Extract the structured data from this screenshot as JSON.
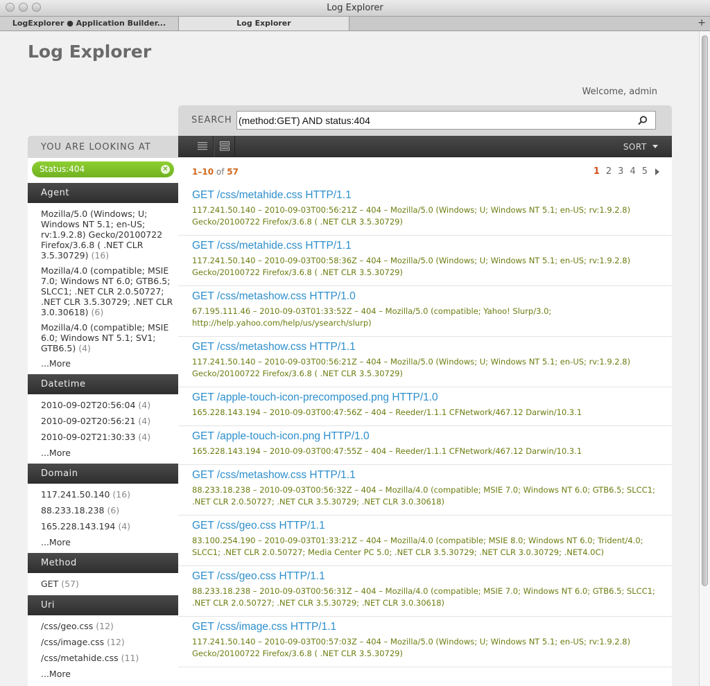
{
  "window": {
    "title": "Log Explorer"
  },
  "tabs": [
    {
      "label": "LogExplorer ● Application Builder..."
    },
    {
      "label": "Log Explorer"
    }
  ],
  "header": {
    "app_title": "Log Explorer",
    "welcome": "Welcome, admin"
  },
  "search": {
    "label": "SEARCH",
    "value": "(method:GET) AND status:404"
  },
  "sidebar": {
    "heading": "YOU ARE LOOKING AT",
    "active_filter": "Status:404",
    "facets": [
      {
        "title": "Agent",
        "items": [
          {
            "text": "Mozilla/5.0 (Windows; U; Windows NT 5.1; en-US; rv:1.9.2.8) Gecko/20100722 Firefox/3.6.8 ( .NET CLR 3.5.30729)",
            "count": "(16)"
          },
          {
            "text": "Mozilla/4.0 (compatible; MSIE 7.0; Windows NT 6.0; GTB6.5; SLCC1; .NET CLR 2.0.50727; .NET CLR 3.5.30729; .NET CLR 3.0.30618)",
            "count": "(6)"
          },
          {
            "text": "Mozilla/4.0 (compatible; MSIE 6.0; Windows NT 5.1; SV1; GTB6.5)",
            "count": "(4)"
          }
        ],
        "more": "...More"
      },
      {
        "title": "Datetime",
        "items": [
          {
            "text": "2010-09-02T20:56:04",
            "count": "(4)"
          },
          {
            "text": "2010-09-02T20:56:21",
            "count": "(4)"
          },
          {
            "text": "2010-09-02T21:30:33",
            "count": "(4)"
          }
        ],
        "more": "...More"
      },
      {
        "title": "Domain",
        "items": [
          {
            "text": "117.241.50.140",
            "count": "(16)"
          },
          {
            "text": "88.233.18.238",
            "count": "(6)"
          },
          {
            "text": "165.228.143.194",
            "count": "(4)"
          }
        ],
        "more": "...More"
      },
      {
        "title": "Method",
        "items": [
          {
            "text": "GET",
            "count": "(57)"
          }
        ],
        "more": ""
      },
      {
        "title": "Uri",
        "items": [
          {
            "text": "/css/geo.css",
            "count": "(12)"
          },
          {
            "text": "/css/image.css",
            "count": "(12)"
          },
          {
            "text": "/css/metahide.css",
            "count": "(11)"
          }
        ],
        "more": "...More"
      }
    ]
  },
  "results": {
    "sort_label": "SORT",
    "range": {
      "start_end": "1–10",
      "of": "of",
      "total": "57"
    },
    "pages": [
      "1",
      "2",
      "3",
      "4",
      "5"
    ],
    "current_page": "1",
    "entries": [
      {
        "request": "GET /css/metahide.css HTTP/1.1",
        "detail": "117.241.50.140 – 2010-09-03T00:56:21Z – 404 – Mozilla/5.0 (Windows; U; Windows NT 5.1; en-US; rv:1.9.2.8) Gecko/20100722 Firefox/3.6.8 ( .NET CLR 3.5.30729)"
      },
      {
        "request": "GET /css/metahide.css HTTP/1.1",
        "detail": "117.241.50.140 – 2010-09-03T00:58:36Z – 404 – Mozilla/5.0 (Windows; U; Windows NT 5.1; en-US; rv:1.9.2.8) Gecko/20100722 Firefox/3.6.8 ( .NET CLR 3.5.30729)"
      },
      {
        "request": "GET /css/metashow.css HTTP/1.0",
        "detail": "67.195.111.46 – 2010-09-03T01:33:52Z – 404 – Mozilla/5.0 (compatible; Yahoo! Slurp/3.0; http://help.yahoo.com/help/us/ysearch/slurp)"
      },
      {
        "request": "GET /css/metashow.css HTTP/1.1",
        "detail": "117.241.50.140 – 2010-09-03T00:56:21Z – 404 – Mozilla/5.0 (Windows; U; Windows NT 5.1; en-US; rv:1.9.2.8) Gecko/20100722 Firefox/3.6.8 ( .NET CLR 3.5.30729)"
      },
      {
        "request": "GET /apple-touch-icon-precomposed.png HTTP/1.0",
        "detail": "165.228.143.194 – 2010-09-03T00:47:56Z – 404 – Reeder/1.1.1 CFNetwork/467.12 Darwin/10.3.1"
      },
      {
        "request": "GET /apple-touch-icon.png HTTP/1.0",
        "detail": "165.228.143.194 – 2010-09-03T00:47:55Z – 404 – Reeder/1.1.1 CFNetwork/467.12 Darwin/10.3.1"
      },
      {
        "request": "GET /css/metashow.css HTTP/1.1",
        "detail": "88.233.18.238 – 2010-09-03T00:56:32Z – 404 – Mozilla/4.0 (compatible; MSIE 7.0; Windows NT 6.0; GTB6.5; SLCC1; .NET CLR 2.0.50727; .NET CLR 3.5.30729; .NET CLR 3.0.30618)"
      },
      {
        "request": "GET /css/geo.css HTTP/1.1",
        "detail": "83.100.254.190 – 2010-09-03T01:33:21Z – 404 – Mozilla/4.0 (compatible; MSIE 8.0; Windows NT 6.0; Trident/4.0; SLCC1; .NET CLR 2.0.50727; Media Center PC 5.0; .NET CLR 3.5.30729; .NET CLR 3.0.30729; .NET4.0C)"
      },
      {
        "request": "GET /css/geo.css HTTP/1.1",
        "detail": "88.233.18.238 – 2010-09-03T00:56:31Z – 404 – Mozilla/4.0 (compatible; MSIE 7.0; Windows NT 6.0; GTB6.5; SLCC1; .NET CLR 2.0.50727; .NET CLR 3.5.30729; .NET CLR 3.0.30618)"
      },
      {
        "request": "GET /css/image.css HTTP/1.1",
        "detail": "117.241.50.140 – 2010-09-03T00:57:03Z – 404 – Mozilla/5.0 (Windows; U; Windows NT 5.1; en-US; rv:1.9.2.8) Gecko/20100722 Firefox/3.6.8 ( .NET CLR 3.5.30729)"
      }
    ]
  },
  "icons": {
    "search": "magnifier-icon",
    "list_view": "list-view-icon",
    "detail_view": "detail-view-icon",
    "remove_filter": "close-icon",
    "sort": "caret-down-icon",
    "next_page": "arrow-right-icon"
  }
}
